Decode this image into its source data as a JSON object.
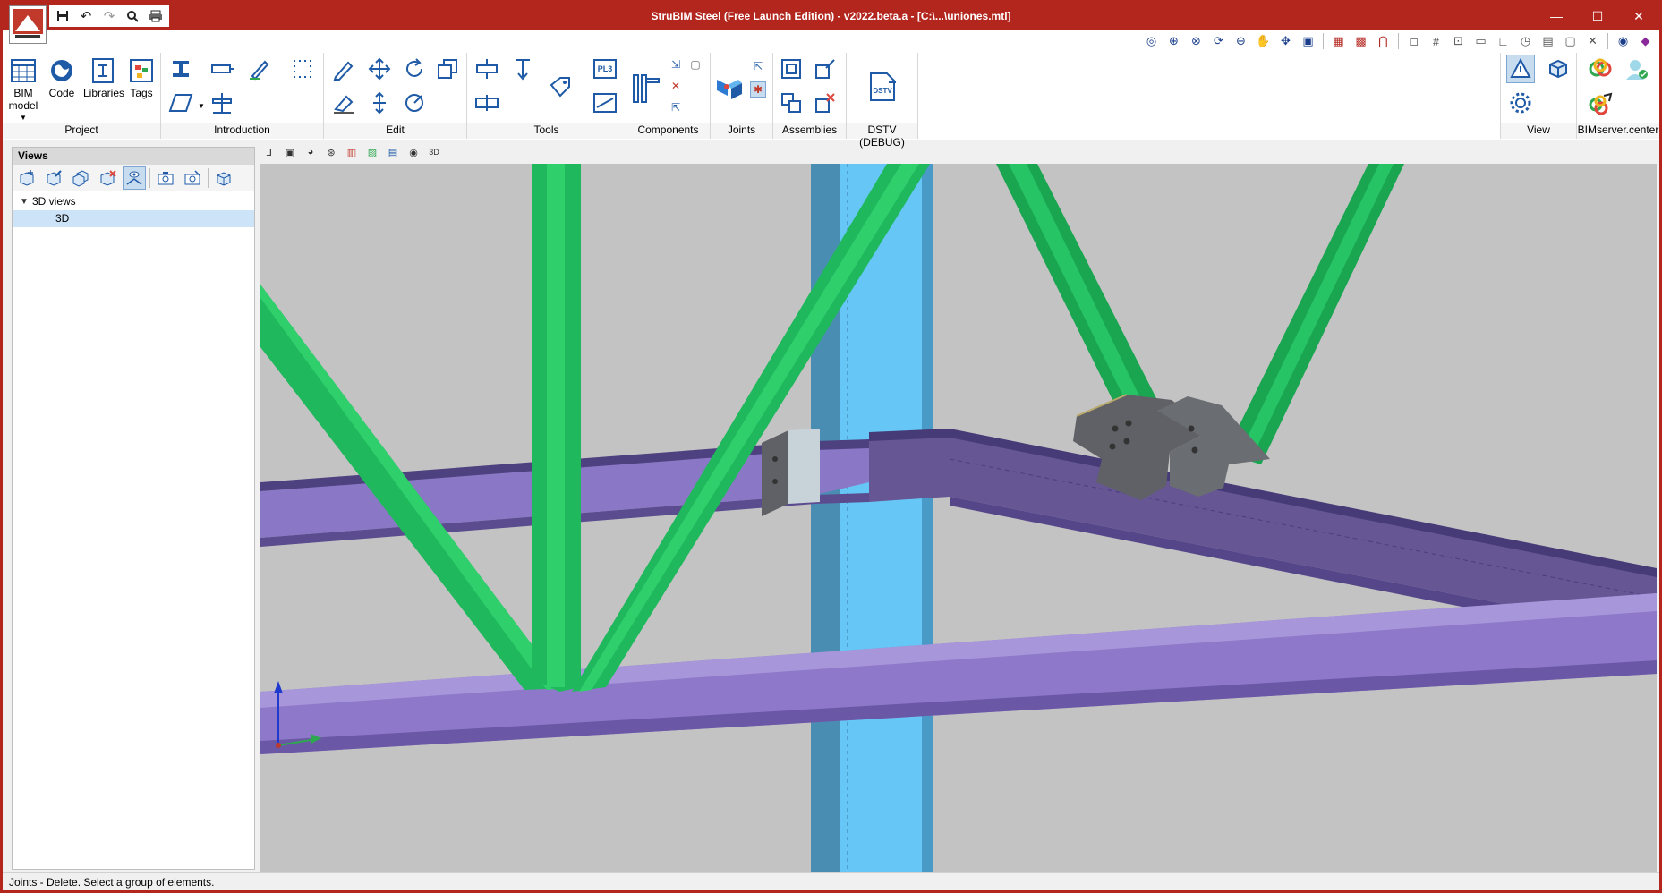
{
  "app": {
    "title": "StruBIM Steel (Free Launch Edition) - v2022.beta.a - [C:\\...\\uniones.mtl]",
    "accent": "#b3261e"
  },
  "quick_access": [
    "save-icon",
    "undo-icon",
    "redo-icon",
    "zoom-icon",
    "print-icon"
  ],
  "window_controls": {
    "minimize": "—",
    "maximize": "☐",
    "close": "✕"
  },
  "ribbon": {
    "groups": {
      "project": "Project",
      "introduction": "Introduction",
      "edit": "Edit",
      "tools": "Tools",
      "components": "Components",
      "joints": "Joints",
      "assemblies": "Assemblies",
      "dstv": "DSTV (DEBUG)",
      "view": "View",
      "bimserver": "BIMserver.center"
    },
    "project_buttons": {
      "bim_model_line1": "BIM",
      "bim_model_line2": "model",
      "code": "Code",
      "libraries": "Libraries",
      "tags": "Tags"
    },
    "tools_plate_label": "PL3",
    "dstv_icon_label": "DSTV"
  },
  "views_panel": {
    "header": "Views",
    "tree_root": "3D views",
    "tree_child": "3D"
  },
  "view_toolbar_3d_label": "3D",
  "status_bar": "Joints - Delete. Select a group of elements.",
  "colors": {
    "viewport_bg": "#c3c3c3",
    "diagonal_tube": "#1fb85c",
    "column": "#5ec4f2",
    "beam": "#7e6bb8",
    "beam_dark": "#5a4c8f",
    "plate": "#5f6166"
  }
}
